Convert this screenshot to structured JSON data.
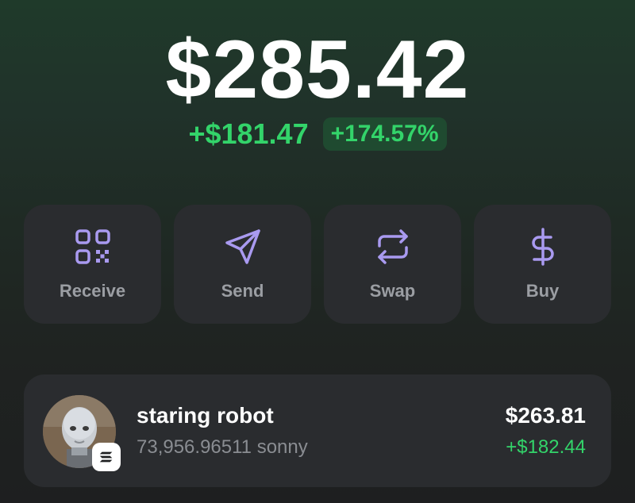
{
  "balance": {
    "total": "$285.42",
    "change_amount": "+$181.47",
    "change_percent": "+174.57%"
  },
  "actions": [
    {
      "label": "Receive",
      "icon": "qr-code-icon"
    },
    {
      "label": "Send",
      "icon": "send-icon"
    },
    {
      "label": "Swap",
      "icon": "swap-icon"
    },
    {
      "label": "Buy",
      "icon": "dollar-icon"
    }
  ],
  "tokens": [
    {
      "name": "staring robot",
      "amount": "73,956.96511 sonny",
      "value": "$263.81",
      "change": "+$182.44",
      "avatar": "robot-avatar",
      "chain_icon": "solana-chain-icon"
    }
  ],
  "colors": {
    "accent": "#a99af0",
    "positive": "#33d46a",
    "card": "#2a2c2f"
  }
}
